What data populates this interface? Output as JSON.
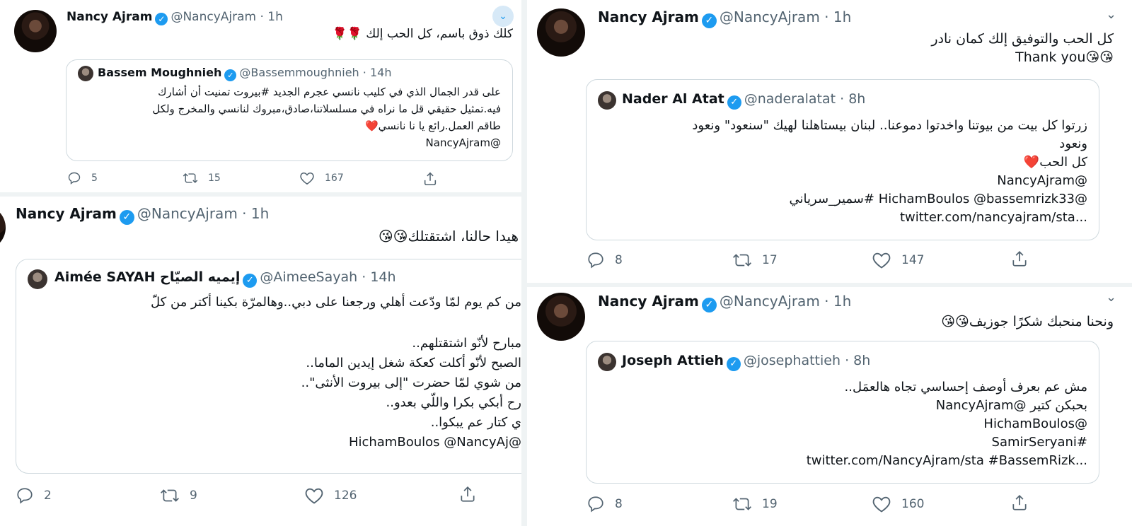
{
  "colors": {
    "verified": "#1d9bf0",
    "muted": "#536471",
    "border": "#cfd9de",
    "heart": "#e0245e"
  },
  "tweets": [
    {
      "name": "Nancy Ajram",
      "handle": "@NancyAjram",
      "time": "1h",
      "sep": "·",
      "text": "كلك ذوق باسم، كل الحب إلك 🌹🌹",
      "quote": {
        "name": "Bassem Moughnieh",
        "handle": "@Bassemmoughnieh",
        "time": "14h",
        "lines": [
          "على قدر الجمال الذي في كليب نانسي عجرم الجديد #بيروت تمنيت أن أشارك",
          "فيه.تمثيل حقيقي قل ما نراه في مسلسلاتنا،صادق،مبروك لنانسي والمخرج ولكل",
          "طاقم العمل.رائع يا نا نانسي❤️",
          "@NancyAjram"
        ]
      },
      "replies": "5",
      "retweets": "15",
      "likes": "167"
    },
    {
      "name": "Nancy Ajram",
      "handle": "@NancyAjram",
      "time": "1h",
      "sep": "·",
      "text": "هيدا حالنا، اشتقتلك😘😘",
      "quote": {
        "name": "Aimée SAYAH إيميه الصيّاح",
        "handle": "@AimeeSayah",
        "time": "14h",
        "lines": [
          "من كم يوم لمّا ودّعت أهلي ورجعنا على دبي..وهالمرّة بكينا أكتر من كلّ",
          "",
          "مبارح لأنّو اشتقتلهم..",
          "الصبح لأنّو أكلت كعكة شغل إيدين الماما..",
          "من شوي لمّا حضرت \"إلى بيروت الأنثى\"..",
          "رح أبكي بكرا واللّي بعدو..",
          "ي كتار عم يبكوا..",
          "@HichamBoulos @NancyAj"
        ]
      },
      "replies": "2",
      "retweets": "9",
      "likes": "126"
    },
    {
      "name": "Nancy Ajram",
      "handle": "@NancyAjram",
      "time": "1h",
      "sep": "·",
      "text_lines": [
        "كل الحب والتوفيق إلك كمان نادر",
        "Thank you😘😘"
      ],
      "quote": {
        "name": "Nader Al Atat",
        "handle": "@naderalatat",
        "time": "8h",
        "lines": [
          "زرتوا كل بيت من بيوتنا واخدتوا دموعنا.. لبنان بيستاهلنا لهيك \"سنعود\" ونعود",
          "ونعود",
          "كل الحب❤️",
          "@NancyAjram",
          "@HichamBoulos @bassemrizk33 #سمير_سرياني",
          "twitter.com/nancyajram/sta..."
        ]
      },
      "replies": "8",
      "retweets": "17",
      "likes": "147"
    },
    {
      "name": "Nancy Ajram",
      "handle": "@NancyAjram",
      "time": "1h",
      "sep": "·",
      "text": "ونحنا منحبك شكرًا جوزيف😘😘",
      "quote": {
        "name": "Joseph Attieh",
        "handle": "@josephattieh",
        "time": "8h",
        "lines": [
          "مش عم بعرف أوصف إحساسي تجاه هالعمَل..",
          "بحبكن كتير @NancyAjram",
          "@HichamBoulos",
          "#SamirSeryani",
          "twitter.com/NancyAjram/sta #BassemRizk..."
        ]
      },
      "replies": "8",
      "retweets": "19",
      "likes": "160"
    }
  ],
  "icons": {
    "verified": "verified-badge-icon",
    "chevron": "chevron-down-icon",
    "reply": "reply-icon",
    "retweet": "retweet-icon",
    "like": "like-icon",
    "share": "share-icon"
  }
}
